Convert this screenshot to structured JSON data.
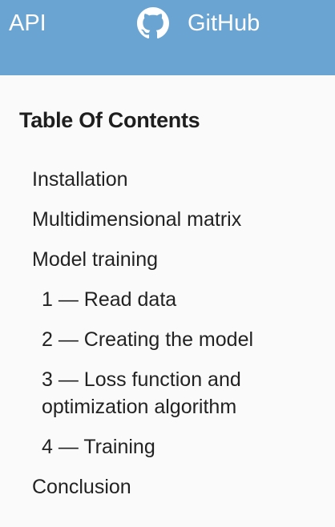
{
  "header": {
    "api_label": "API",
    "github_label": "GitHub",
    "background": "#6aa4d2",
    "icon": "github-icon"
  },
  "toc": {
    "title": "Table Of Contents",
    "items": [
      {
        "label": "Installation"
      },
      {
        "label": "Multidimensional matrix"
      },
      {
        "label": "Model training"
      },
      {
        "label": "1 — Read data"
      },
      {
        "label": "2 — Creating the model"
      },
      {
        "label": "3 — Loss function and optimization algorithm"
      },
      {
        "label": "4 — Training"
      },
      {
        "label": "Conclusion"
      }
    ]
  }
}
